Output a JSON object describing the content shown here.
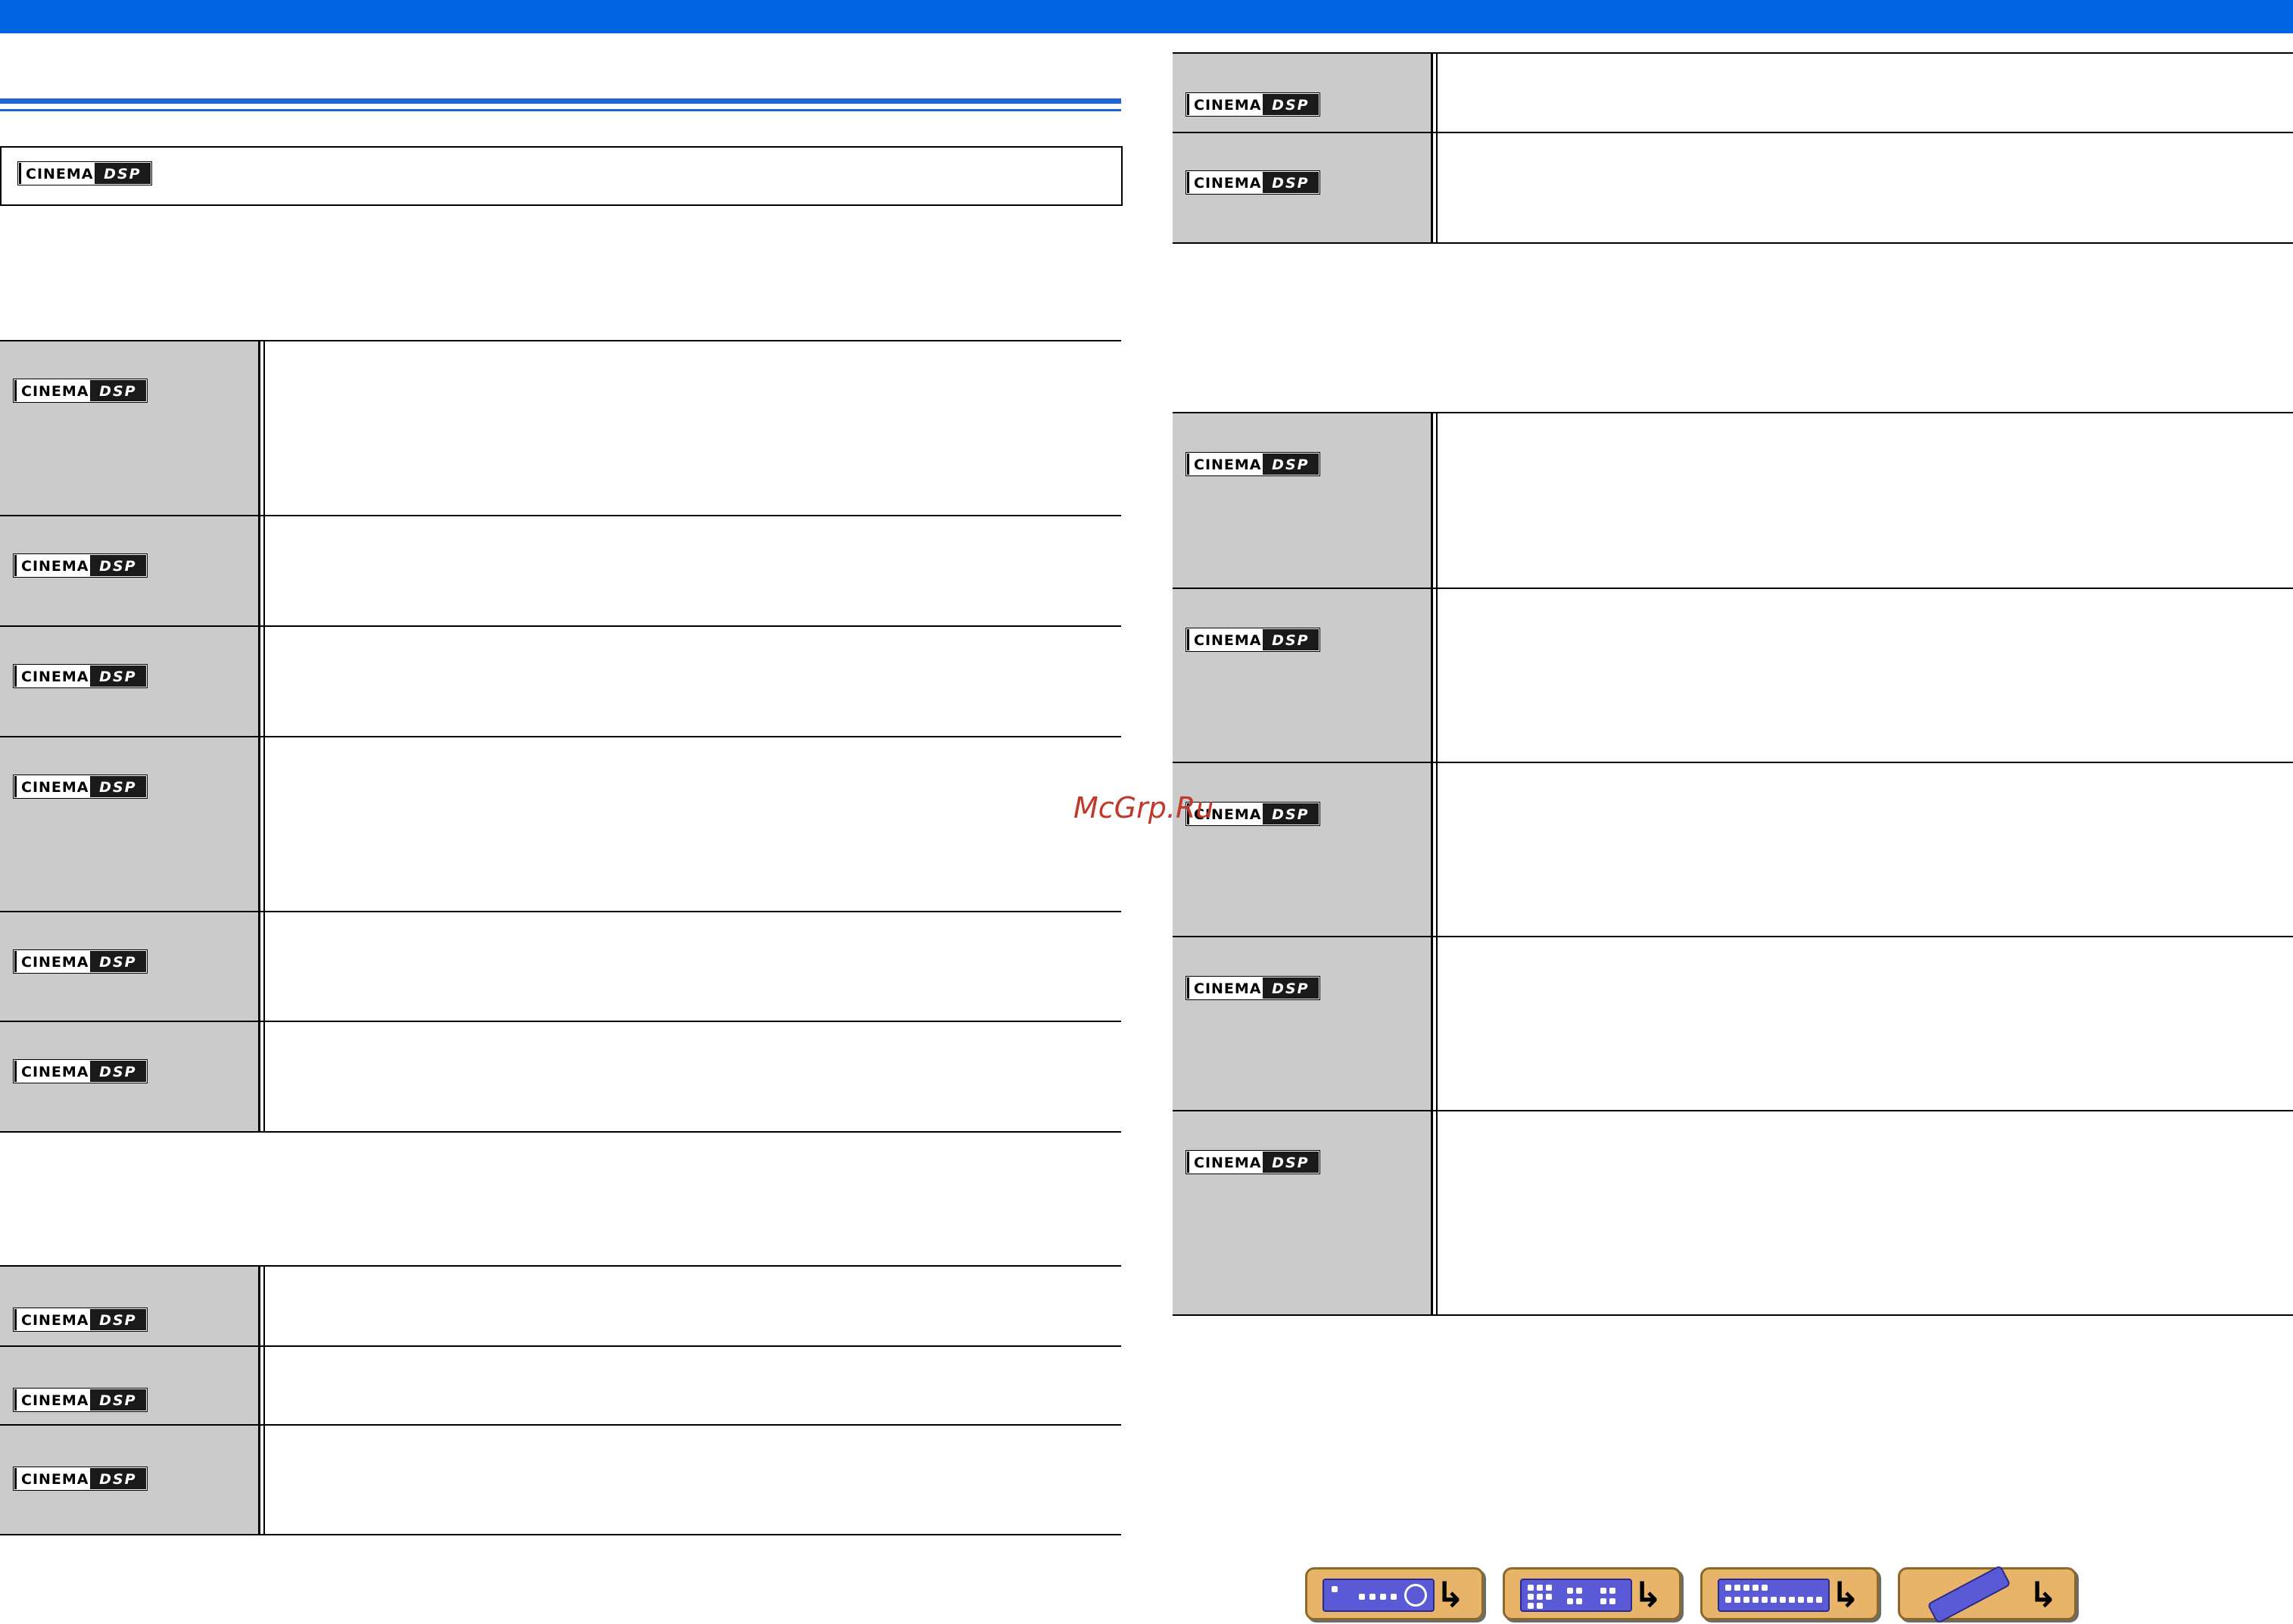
{
  "colors": {
    "header_bar": "#0064e1",
    "rule": "#1e64d2",
    "cell_gray": "#cbcbcb",
    "nav_button": "#e8b46a",
    "watermark": "#c0392b"
  },
  "brand_logo": {
    "left": "CINEMA",
    "right": "DSP",
    "icon": "cinema-dsp-logo"
  },
  "watermark": {
    "text": "McGrp.Ru"
  },
  "boxed_header": {
    "logo": "cinema-dsp-logo"
  },
  "tables": {
    "left_top_rows": 6,
    "left_bottom_rows": 3,
    "right_top_rows": 2,
    "right_bottom_rows": 5
  },
  "navigation": [
    {
      "label": "front-panel",
      "icon": "front-panel-icon",
      "arrow": "↳"
    },
    {
      "label": "rear-panel",
      "icon": "rear-panel-icon",
      "arrow": "↳"
    },
    {
      "label": "display",
      "icon": "display-icon",
      "arrow": "↳"
    },
    {
      "label": "remote-control",
      "icon": "remote-control-icon",
      "arrow": "↳"
    }
  ]
}
